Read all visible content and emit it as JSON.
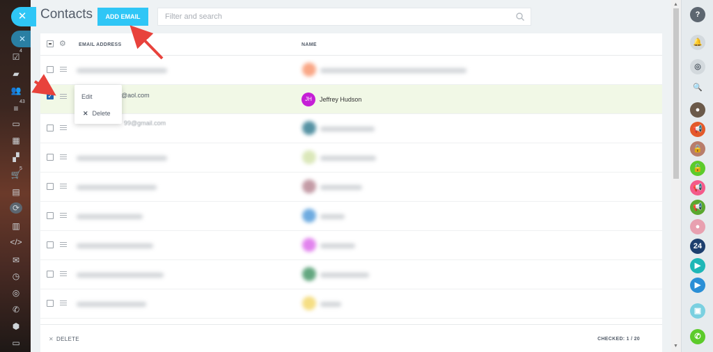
{
  "header": {
    "title": "Contacts",
    "add_email_label": "ADD EMAIL",
    "search_placeholder": "Filter and search"
  },
  "grid": {
    "columns": [
      "EMAIL ADDRESS",
      "NAME"
    ],
    "selected_row": {
      "email_visible": "@aol.com",
      "name": "Jeffrey Hudson",
      "initials": "JH"
    },
    "row3_email_partial": "99@gmail.com"
  },
  "context_menu": {
    "items": [
      "Edit",
      "Delete"
    ]
  },
  "footer": {
    "delete_label": "DELETE",
    "checked_label": "CHECKED: 1 / 20"
  },
  "right_sidebar": {
    "badge_24": "24"
  },
  "left_sidebar": {
    "badges": [
      "4",
      "43",
      "5"
    ]
  },
  "colors": {
    "accent": "#2fc6f6",
    "selected_row": "#f1f8e6",
    "avatar": "#c51fd6",
    "annotation_arrow": "#e8423c"
  }
}
